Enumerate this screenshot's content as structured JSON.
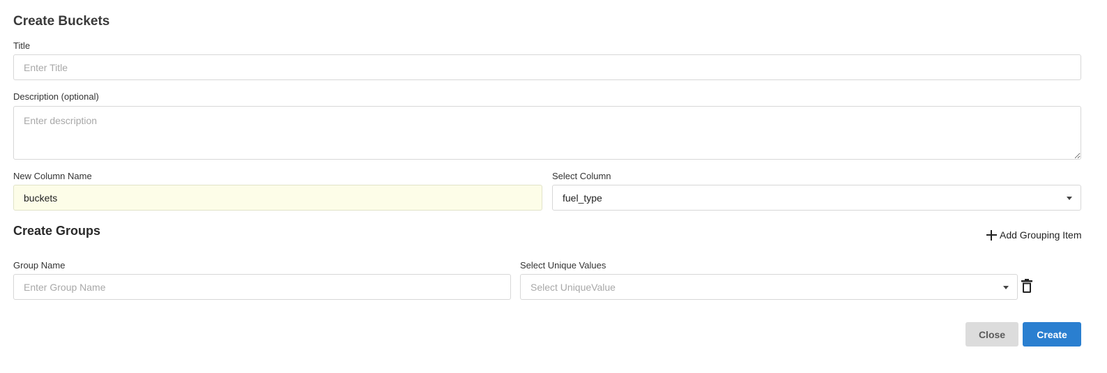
{
  "dialog": {
    "title": "Create Buckets"
  },
  "form": {
    "title_label": "Title",
    "title_placeholder": "Enter Title",
    "title_value": "",
    "description_label": "Description (optional)",
    "description_placeholder": "Enter description",
    "new_column_label": "New Column Name",
    "new_column_value": "buckets",
    "select_column_label": "Select Column",
    "select_column_value": "fuel_type"
  },
  "groups": {
    "heading": "Create Groups",
    "add_label": "Add Grouping Item",
    "add_icon": "plus-icon",
    "delete_icon": "trash-icon",
    "items": [
      {
        "group_name_label": "Group Name",
        "group_name_placeholder": "Enter Group Name",
        "unique_values_label": "Select Unique Values",
        "unique_values_placeholder": "Select UniqueValue"
      }
    ]
  },
  "actions": {
    "close_label": "Close",
    "create_label": "Create"
  },
  "colors": {
    "primary": "#2a7fd0",
    "secondary": "#dcdcdc",
    "autofill_bg": "#fdfde8"
  }
}
